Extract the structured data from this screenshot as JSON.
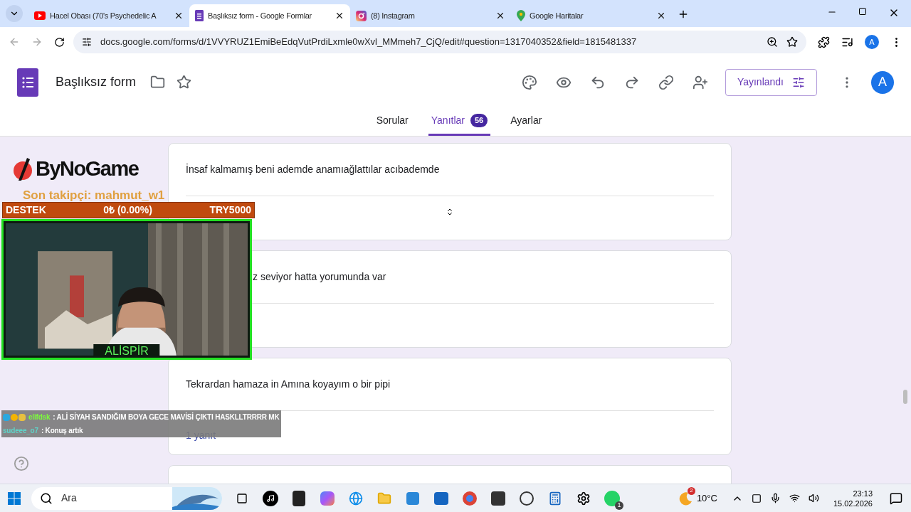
{
  "browser_tabs": [
    {
      "kind": "video",
      "title": "Hacel Obası (70's Psychedelic A",
      "selected": false
    },
    {
      "kind": "forms",
      "title": "Başlıksız form - Google Formlar",
      "selected": true
    },
    {
      "title": "(8) Instagram",
      "selected": false
    },
    {
      "kind": "maps",
      "title": "Google Haritalar",
      "selected": false
    }
  ],
  "address_bar": {
    "url": "docs.google.com/forms/d/1VVYRUZ1EmiBeEdqVutPrdiLxmle0wXvl_MMmeh7_CjQ/edit#question=1317040352&field=1815481337"
  },
  "profile_initial": "A",
  "form": {
    "title": "Başlıksız form",
    "publish_button": "Yayınlandı",
    "account_initial": "A",
    "tabs": [
      {
        "label": "Sorular",
        "selected": false
      },
      {
        "label": "Yanıtlar",
        "selected": true,
        "badge": "56"
      },
      {
        "label": "Ayarlar",
        "selected": false
      }
    ],
    "responses": [
      {
        "text": "İnsaf kalmamış beni ademde anamıağlattılar acıbademde",
        "kind": "select"
      },
      {
        "text": "z seviyor hatta yorumunda var",
        "kind": "plain"
      },
      {
        "text": "Tekrardan hamaza in Amına koyayım o bir pipi",
        "kind": "count",
        "count": "1 yanıt"
      }
    ]
  },
  "stream_overlay": {
    "sponsor": "ByNoGame",
    "last_follower": "Son takipçi: mahmut_w1",
    "donation_bar": {
      "label": "DESTEK",
      "amount": "0₺ (0.00%)",
      "goal": "TRY5000"
    },
    "webcam": {
      "kind": "picture",
      "name_tag": "ALİSPİR"
    },
    "chat": [
      {
        "user": "elifdsk",
        "message": " : ALİ SİYAH SANDIĞIM BOYA GECE MAVİSİ ÇIKTI HASKLLTRRRR MK",
        "color": "#7cfc3c",
        "badges": true
      },
      {
        "user": "sudeee_o7",
        "message": " : Konuş artık",
        "color": "#5fd3c8",
        "badges": false
      }
    ]
  },
  "taskbar": {
    "search": "Ara",
    "weather": {
      "temperature": "10°C",
      "badge": "2"
    },
    "whatsapp_badge": "1",
    "time": "23:13",
    "date": "15.02.2026"
  }
}
